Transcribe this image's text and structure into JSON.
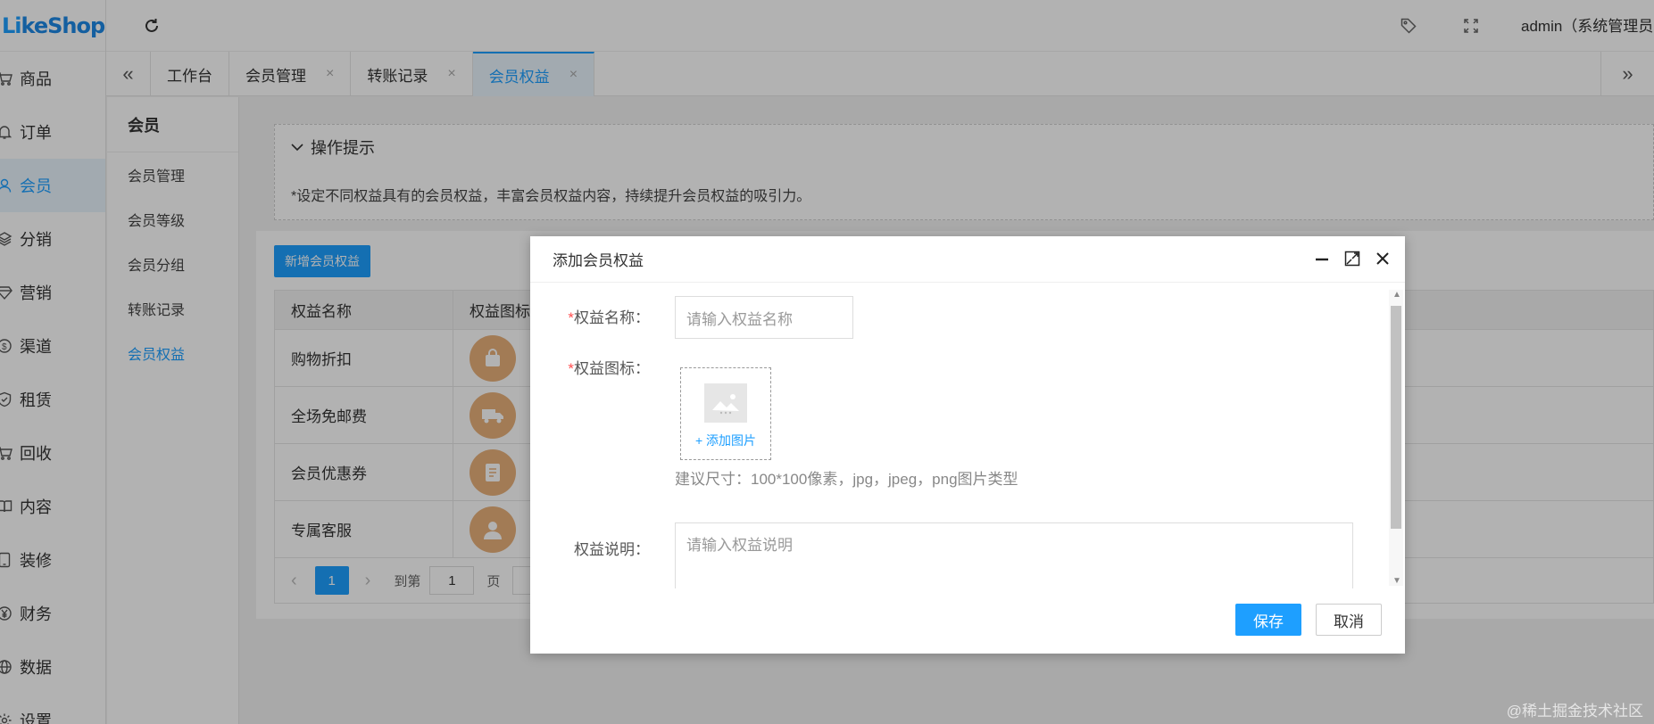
{
  "logo": {
    "part1": "Li",
    "part2": "keShop"
  },
  "sidebar": {
    "items": [
      {
        "label": "商品",
        "icon": "cart-icon"
      },
      {
        "label": "订单",
        "icon": "bell-icon"
      },
      {
        "label": "会员",
        "icon": "user-icon",
        "active": true
      },
      {
        "label": "分销",
        "icon": "layers-icon"
      },
      {
        "label": "营销",
        "icon": "diamond-icon"
      },
      {
        "label": "渠道",
        "icon": "coin-icon"
      },
      {
        "label": "租赁",
        "icon": "shield-icon"
      },
      {
        "label": "回收",
        "icon": "recycle-cart-icon"
      },
      {
        "label": "内容",
        "icon": "book-icon"
      },
      {
        "label": "装修",
        "icon": "tablet-icon"
      },
      {
        "label": "财务",
        "icon": "yen-icon"
      },
      {
        "label": "数据",
        "icon": "globe-icon"
      },
      {
        "label": "设置",
        "icon": "gear-icon"
      }
    ]
  },
  "header": {
    "user": "admin（系统管理员"
  },
  "tabs": [
    {
      "label": "工作台",
      "closable": false
    },
    {
      "label": "会员管理",
      "closable": true
    },
    {
      "label": "转账记录",
      "closable": true
    },
    {
      "label": "会员权益",
      "closable": true,
      "active": true
    }
  ],
  "subsidebar": {
    "title": "会员",
    "items": [
      "会员管理",
      "会员等级",
      "会员分组",
      "转账记录",
      "会员权益"
    ],
    "active_index": 4
  },
  "tips": {
    "title": "操作提示",
    "text": "*设定不同权益具有的会员权益，丰富会员权益内容，持续提升会员权益的吸引力。"
  },
  "main": {
    "add_button": "新增会员权益",
    "table": {
      "headers": [
        "权益名称",
        "权益图标"
      ],
      "rows": [
        {
          "name": "购物折扣",
          "icon": "bag-icon"
        },
        {
          "name": "全场免邮费",
          "icon": "truck-icon"
        },
        {
          "name": "会员优惠券",
          "icon": "ticket-icon"
        },
        {
          "name": "专属客服",
          "icon": "person-icon"
        }
      ]
    },
    "pager": {
      "current": "1",
      "goto_label": "到第",
      "goto_value": "1",
      "unit": "页"
    }
  },
  "modal": {
    "title": "添加会员权益",
    "name_label": "权益名称：",
    "name_placeholder": "请输入权益名称",
    "icon_label": "权益图标：",
    "add_image": "+ 添加图片",
    "hint": "建议尺寸：100*100像素，jpg，jpeg，png图片类型",
    "desc_label": "权益说明：",
    "desc_placeholder": "请输入权益说明",
    "required_mark": "*",
    "save": "保存",
    "cancel": "取消"
  },
  "watermark": "@稀土掘金技术社区",
  "colors": {
    "accent": "#1e9fff",
    "icon_bg": "#e8b07a",
    "required": "#ff4d4f"
  }
}
